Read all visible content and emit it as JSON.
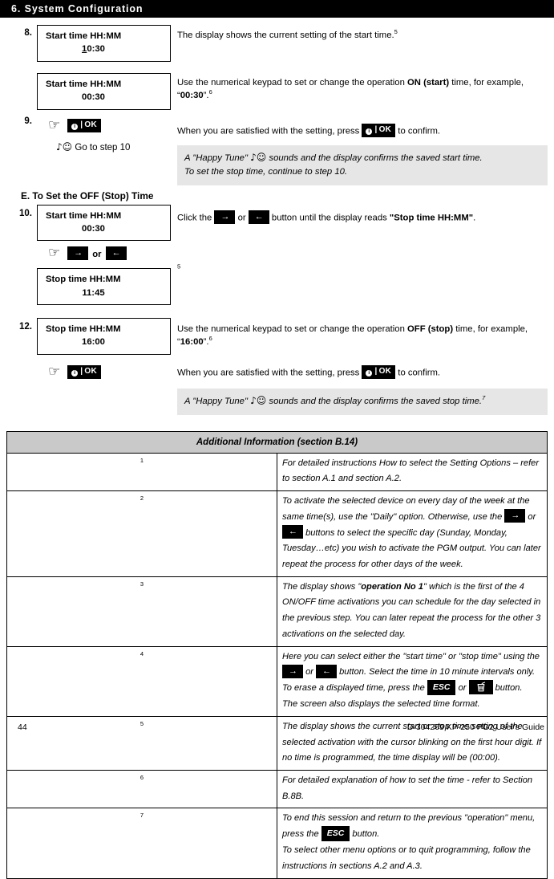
{
  "chapter": {
    "title": "6. System Configuration"
  },
  "steps": [
    {
      "number": "8.",
      "display_a": {
        "line1": "Start time HH:MM",
        "cursor": "1",
        "value_rest": "0:30"
      },
      "text_a": "The display shows the current setting of the start time.",
      "text_a_sup": "5",
      "display_b": {
        "line1": "Start time HH:MM",
        "line2": "00:30"
      },
      "text_b_1": "Use the numerical keypad to set or change the operation ",
      "text_b_bold": "ON (start)",
      "text_b_2": " time, for example, “",
      "text_b_value": "00:30",
      "text_b_3": "”.",
      "text_b_sup": "6"
    },
    {
      "number": "9.",
      "hand_icon": "pointing-hand-icon",
      "key_ok": "OK",
      "confirm_text_1": "When you are satisfied with the setting, press ",
      "confirm_text_2": " to confirm.",
      "goto_text": "Go to step 10",
      "note_line1": "A \"Happy Tune\"  sounds and the display confirms the saved start time.",
      "note_line2": "To set the stop time, continue to step 10."
    }
  ],
  "section_e": {
    "heading": "E. To Set the OFF (Stop) Time"
  },
  "step10": {
    "number": "10.",
    "display_a": {
      "line1": "Start time HH:MM",
      "line2": "00:30"
    },
    "text_1": "Click the ",
    "text_2": " or ",
    "text_3": " button until the display reads ",
    "text_bold": "\"Stop time HH:MM\"",
    "text_4": ".",
    "key_right": "→",
    "key_left": "←",
    "or_label": "or",
    "display_b": {
      "line1": "Stop time HH:MM",
      "line2": "11:45"
    },
    "display_b_sup": "5"
  },
  "step12": {
    "number": "12.",
    "display": {
      "line1": "Stop time HH:MM",
      "line2": "16:00"
    },
    "text_1": "Use the numerical keypad to set or change the operation ",
    "text_bold": "OFF (stop)",
    "text_2": " time, for example, “",
    "text_value": "16:00",
    "text_3": "”.",
    "text_sup": "6",
    "key_ok": "OK",
    "confirm_text_1": "When you are satisfied with the setting, press ",
    "confirm_text_2": " to confirm.",
    "note_line": "A \"Happy Tune\"  sounds and the display confirms the saved stop time.",
    "note_sup": "7"
  },
  "addinfo": {
    "title": "Additional Information (section B.14)",
    "rows": [
      {
        "index": "1",
        "paragraphs": [
          "For detailed instructions How to select the Setting Options – refer to section A.1 and section A.2."
        ]
      },
      {
        "index": "2",
        "inline": true,
        "seg1": "To activate the selected device on every day of the week at the same time(s), use the \"Daily\" option. Otherwise, use the ",
        "seg2": " or ",
        "seg3": " buttons to select the specific day (Sunday, Monday, Tuesday…etc) you wish to activate the PGM output. You can later repeat the process for other days of the week.",
        "key_right": "→",
        "key_left": "←"
      },
      {
        "index": "3",
        "rich": true,
        "seg1": "The display shows \"",
        "bold_text": "operation No 1",
        "seg2": "\" which is the first of the 4 ON/OFF time activations you can schedule for the day selected in the previous step. You can later repeat the process for the other 3 activations on the selected day."
      },
      {
        "index": "4",
        "footnote4": true,
        "seg1": "Here you can select either the \"start time\" or \"stop time\" using the ",
        "seg2": " or ",
        "seg3": " button. Select the time in 10 minute intervals only. To erase a displayed time, press the ",
        "seg4": " or ",
        "seg5": " button.",
        "line2": "The screen also displays the selected time format.",
        "key_right": "→",
        "key_left": "←",
        "key_esc": "ESC",
        "key_trash": "trash-icon"
      },
      {
        "index": "5",
        "paragraphs": [
          "The display shows the current start or stop time setting of the selected activation with the cursor blinking on the first hour digit. If no time is programmed, the time display will be (00:00)."
        ]
      },
      {
        "index": "6",
        "paragraphs": [
          "For detailed explanation of how to set the time - refer to Section B.8B."
        ]
      },
      {
        "index": "7",
        "footnote7": true,
        "seg1": "To end this session and return to the previous \"operation\" menu, press the ",
        "seg2": " button.",
        "key_esc": "ESC",
        "line2": "To select other menu options or to quit programming, follow the instructions in sections A.2 and A.3."
      }
    ]
  },
  "footer": {
    "page_number": "44",
    "doc_id": "D-304269 KP-250 PG2 User's Guide"
  }
}
